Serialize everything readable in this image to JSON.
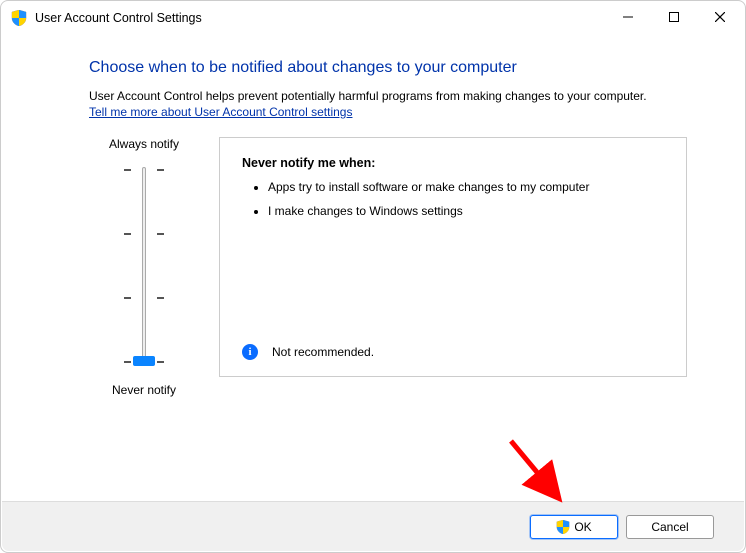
{
  "window": {
    "title": "User Account Control Settings"
  },
  "heading": "Choose when to be notified about changes to your computer",
  "description": "User Account Control helps prevent potentially harmful programs from making changes to your computer.",
  "help_link": "Tell me more about User Account Control settings",
  "slider": {
    "top_label": "Always notify",
    "bottom_label": "Never notify",
    "level_count": 4,
    "current_level_index": 3
  },
  "detail": {
    "title": "Never notify me when:",
    "bullets": [
      "Apps try to install software or make changes to my computer",
      "I make changes to Windows settings"
    ],
    "recommendation": "Not recommended."
  },
  "buttons": {
    "ok": "OK",
    "cancel": "Cancel"
  }
}
